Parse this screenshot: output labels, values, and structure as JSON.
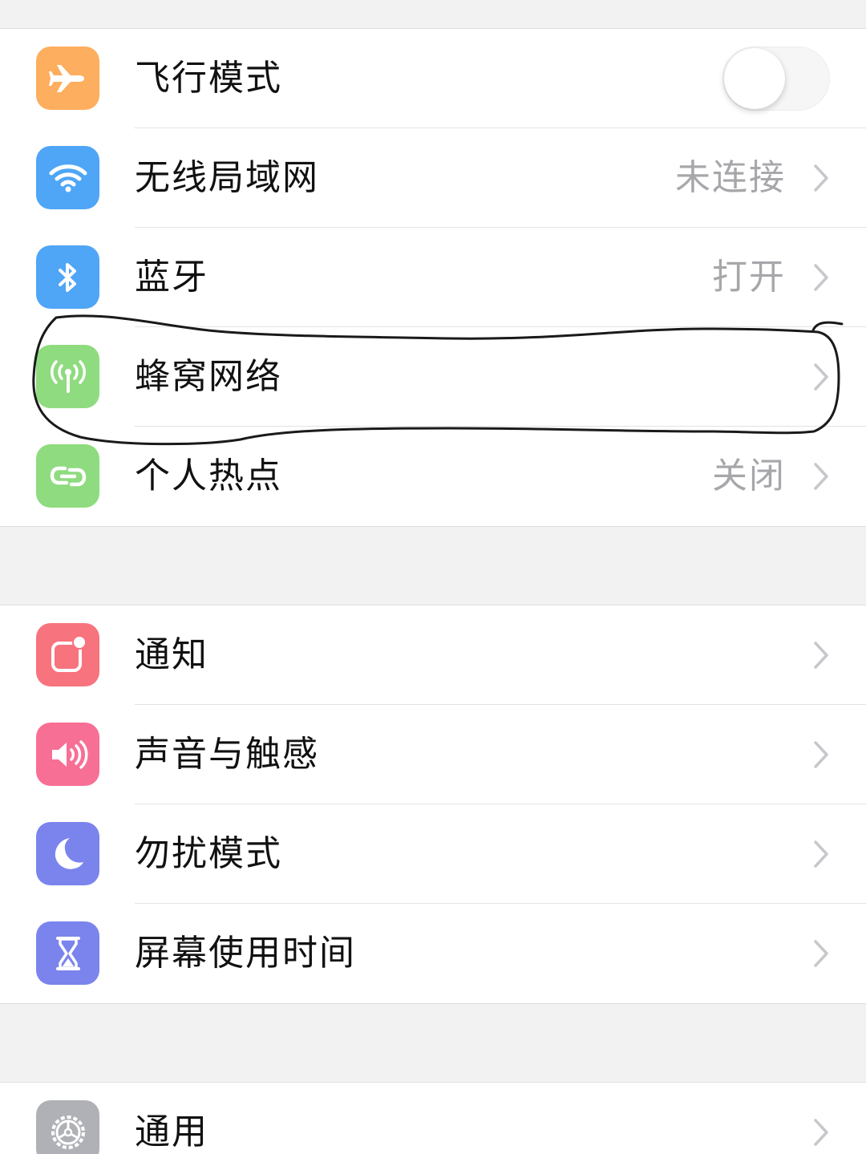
{
  "colors": {
    "airplane": "#fdae5e",
    "wifi": "#4fa5f6",
    "bluetooth": "#4fa5f6",
    "cellular": "#8fdb7f",
    "hotspot": "#8fdb7f",
    "notifications": "#f7737e",
    "sounds": "#f86f96",
    "dnd": "#7b84ec",
    "screentime": "#7b84ec",
    "general": "#b0b1b6",
    "annotation_ink": "#1a1a1a"
  },
  "groups": [
    {
      "items": [
        {
          "label": "飞行模式",
          "icon": "airplane-icon",
          "toggle": "off"
        },
        {
          "label": "无线局域网",
          "value": "未连接",
          "icon": "wifi-icon"
        },
        {
          "label": "蓝牙",
          "value": "打开",
          "icon": "bluetooth-icon"
        },
        {
          "label": "蜂窝网络",
          "value": "",
          "icon": "cellular-antenna-icon",
          "annotated": true
        },
        {
          "label": "个人热点",
          "value": "关闭",
          "icon": "personal-hotspot-icon"
        }
      ]
    },
    {
      "items": [
        {
          "label": "通知",
          "icon": "notifications-icon"
        },
        {
          "label": "声音与触感",
          "icon": "speaker-icon"
        },
        {
          "label": "勿扰模式",
          "icon": "moon-icon"
        },
        {
          "label": "屏幕使用时间",
          "icon": "hourglass-icon"
        }
      ]
    },
    {
      "items": [
        {
          "label": "通用",
          "icon": "gear-icon"
        }
      ]
    }
  ]
}
